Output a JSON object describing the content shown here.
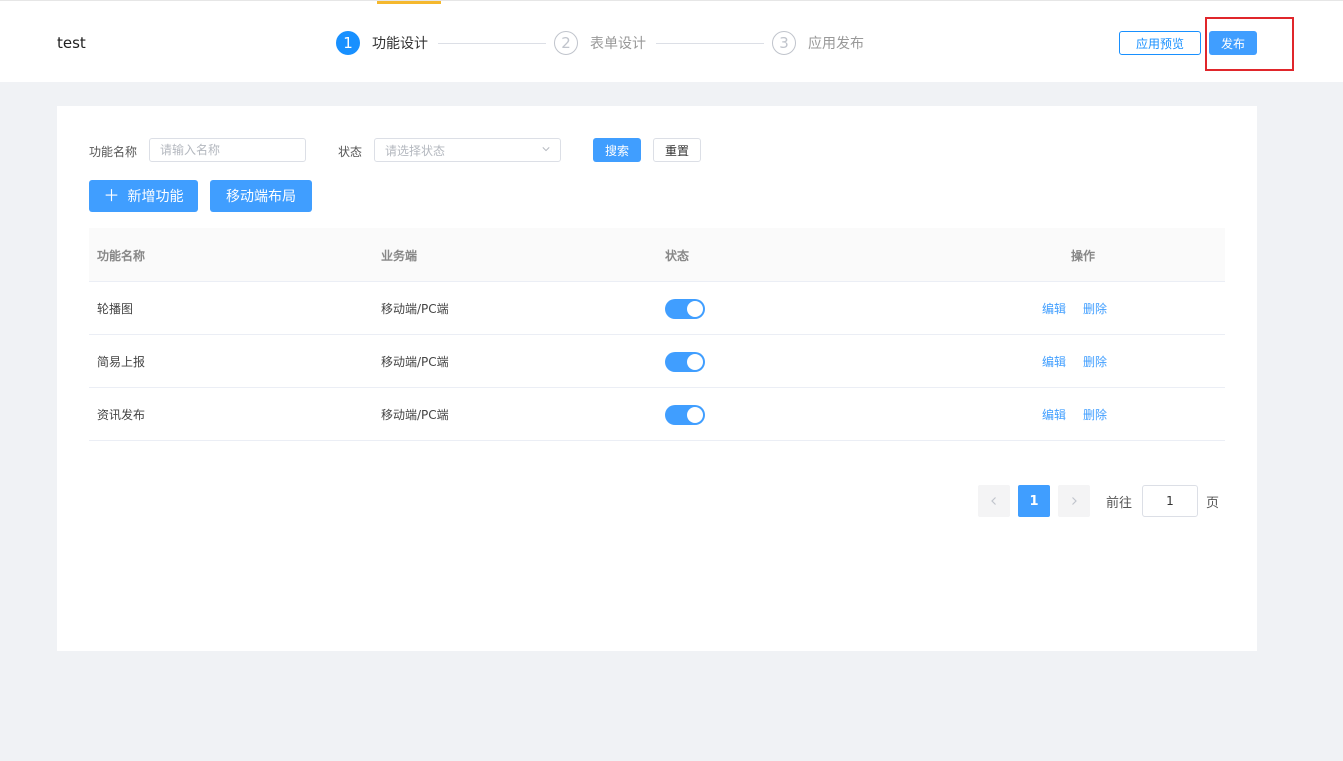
{
  "header": {
    "app_title": "test",
    "steps": [
      {
        "number": "1",
        "label": "功能设计",
        "active": true
      },
      {
        "number": "2",
        "label": "表单设计",
        "active": false
      },
      {
        "number": "3",
        "label": "应用发布",
        "active": false
      }
    ],
    "preview_label": "应用预览",
    "publish_label": "发布"
  },
  "filters": {
    "name_label": "功能名称",
    "name_placeholder": "请输入名称",
    "status_label": "状态",
    "status_placeholder": "请选择状态",
    "search_label": "搜索",
    "reset_label": "重置"
  },
  "actions": {
    "add_label": "新增功能",
    "mobile_layout_label": "移动端布局"
  },
  "table": {
    "columns": [
      "功能名称",
      "业务端",
      "状态",
      "操作"
    ],
    "rows": [
      {
        "name": "轮播图",
        "platform": "移动端/PC端",
        "enabled": true,
        "edit": "编辑",
        "delete": "删除"
      },
      {
        "name": "简易上报",
        "platform": "移动端/PC端",
        "enabled": true,
        "edit": "编辑",
        "delete": "删除"
      },
      {
        "name": "资讯发布",
        "platform": "移动端/PC端",
        "enabled": true,
        "edit": "编辑",
        "delete": "删除"
      }
    ]
  },
  "pagination": {
    "current_page": "1",
    "goto_label": "前往",
    "goto_value": "1",
    "page_suffix": "页"
  },
  "colors": {
    "primary": "#409eff",
    "step_active": "#1890ff",
    "highlight": "#e0262b",
    "accent_bar": "#f5b82e"
  }
}
